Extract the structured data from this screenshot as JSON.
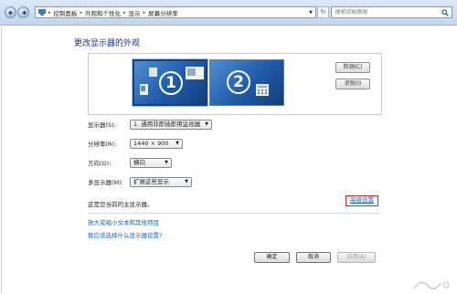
{
  "address": {
    "breadcrumb": [
      "控制面板",
      "外观和个性化",
      "显示",
      "屏幕分辨率"
    ],
    "search_placeholder": "搜索控制面板"
  },
  "page": {
    "title": "更改显示器的外观",
    "detect_label": "检测(C)",
    "identify_label": "识别(I)",
    "monitor1_number": "1",
    "monitor2_number": "2"
  },
  "settings": {
    "display_label": "显示器(S):",
    "display_value": "1. 通用非即插即用监视器",
    "resolution_label": "分辨率(R):",
    "resolution_value": "1440 × 900",
    "orientation_label": "方向(O):",
    "orientation_value": "横向",
    "multi_label": "多显示器(M):",
    "multi_value": "扩展这些显示"
  },
  "status": {
    "primary_note": "这是您当前的主显示器。",
    "advanced_link": "高级设置"
  },
  "links": {
    "text_size": "放大或缩小文本和其他项目",
    "which_settings": "我应该选择什么显示器设置?"
  },
  "buttons": {
    "ok": "确定",
    "cancel": "取消",
    "apply": "应用(A)"
  },
  "colors": {
    "title": "#1e3287",
    "link": "#0b66c3",
    "highlight_box": "#e02020",
    "monitor_blue": "#1f5aa8"
  }
}
